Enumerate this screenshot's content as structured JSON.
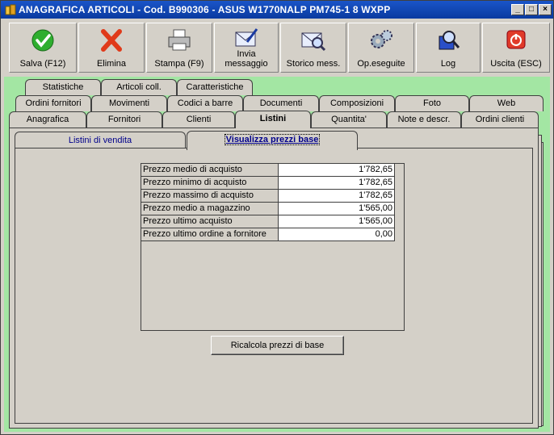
{
  "window": {
    "title": "ANAGRAFICA ARTICOLI - Cod. B990306 - ASUS W1770NALP PM745-1 8 WXPP",
    "controls": {
      "minimize": "_",
      "maximize": "□",
      "close": "×"
    }
  },
  "toolbar": {
    "buttons": [
      {
        "label": "Salva (F12)",
        "icon": "check-icon"
      },
      {
        "label": "Elimina",
        "icon": "red-x-icon"
      },
      {
        "label": "Stampa (F9)",
        "icon": "printer-icon"
      },
      {
        "label_line1": "Invia",
        "label_line2": "messaggio",
        "icon": "envelope-pen-icon"
      },
      {
        "label": "Storico mess.",
        "icon": "envelope-search-icon"
      },
      {
        "label": "Op.eseguite",
        "icon": "gears-icon"
      },
      {
        "label": "Log",
        "icon": "magnifier-book-icon"
      },
      {
        "label": "Uscita (ESC)",
        "icon": "power-icon"
      }
    ]
  },
  "tabs": {
    "row1": [
      "Statistiche",
      "Articoli coll.",
      "Caratteristiche"
    ],
    "row2": [
      "Ordini fornitori",
      "Movimenti",
      "Codici a barre",
      "Documenti",
      "Composizioni",
      "Foto",
      "Web"
    ],
    "row3": [
      "Anagrafica",
      "Fornitori",
      "Clienti",
      "Listini",
      "Quantita'",
      "Note e descr.",
      "Ordini clienti"
    ],
    "active": "Listini"
  },
  "subtabs": {
    "items": [
      "Listini di vendita",
      "Visualizza prezzi base"
    ],
    "active": "Visualizza prezzi base"
  },
  "prices": {
    "rows": [
      {
        "label": "Prezzo medio di acquisto",
        "value": "1'782,65"
      },
      {
        "label": "Prezzo minimo di acquisto",
        "value": "1'782,65"
      },
      {
        "label": "Prezzo massimo di acquisto",
        "value": "1'782,65"
      },
      {
        "label": "Prezzo medio a magazzino",
        "value": "1'565,00"
      },
      {
        "label": "Prezzo ultimo acquisto",
        "value": "1'565,00"
      },
      {
        "label": "Prezzo ultimo ordine a fornitore",
        "value": "0,00"
      }
    ]
  },
  "recalc_button": "Ricalcola prezzi di base",
  "colors": {
    "title_bar": "#0a3aa0",
    "background_green": "#a3e6a3",
    "face": "#d4d0c8",
    "active_subtab_text": "#00008b"
  }
}
